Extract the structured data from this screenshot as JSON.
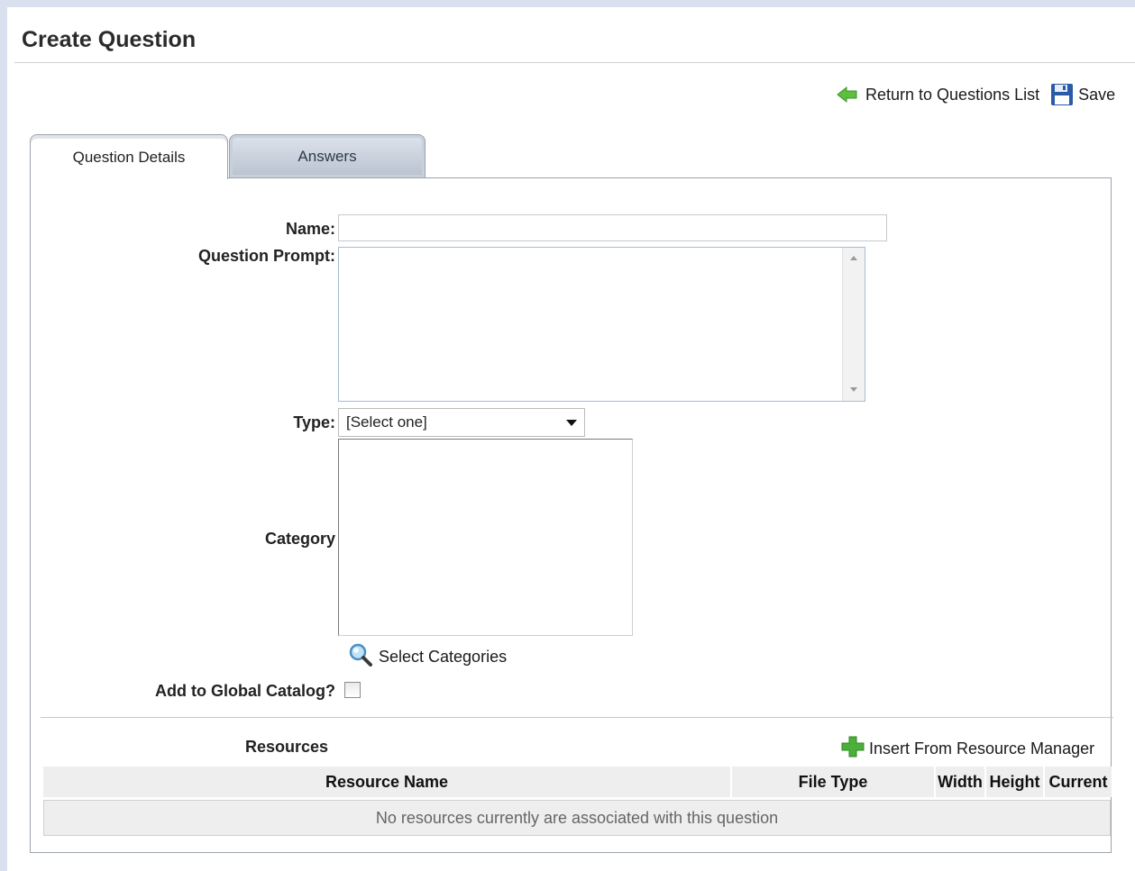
{
  "page": {
    "title": "Create Question"
  },
  "toolbar": {
    "return_label": "Return to Questions List",
    "save_label": "Save"
  },
  "tabs": [
    {
      "label": "Question Details",
      "active": true
    },
    {
      "label": "Answers",
      "active": false
    }
  ],
  "form": {
    "name_label": "Name:",
    "name_value": "",
    "prompt_label": "Question Prompt:",
    "prompt_value": "",
    "type_label": "Type:",
    "type_selected": "[Select one]",
    "category_label": "Category",
    "select_categories_label": "Select Categories",
    "global_catalog_label": "Add to Global Catalog?",
    "global_catalog_checked": false
  },
  "resources": {
    "title": "Resources",
    "insert_label": "Insert From Resource Manager",
    "columns": [
      "Resource Name",
      "File Type",
      "Width",
      "Height",
      "Current"
    ],
    "empty_message": "No resources currently are associated with this question"
  },
  "colors": {
    "accent_green": "#4caf3a",
    "save_blue": "#2a5aa8",
    "tab_inactive": "#c3cbd6"
  }
}
